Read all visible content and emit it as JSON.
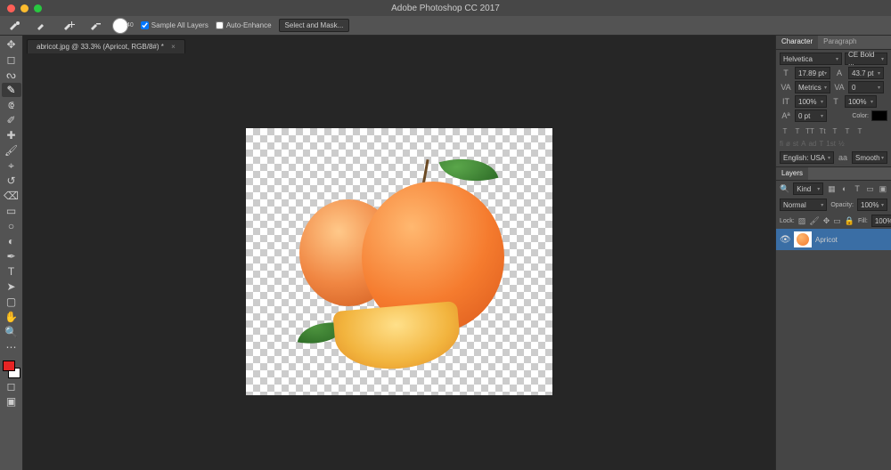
{
  "app": {
    "title": "Adobe Photoshop CC 2017"
  },
  "options": {
    "brush_size": "40",
    "sample_all_layers": "Sample All Layers",
    "auto_enhance": "Auto-Enhance",
    "select_and_mask": "Select and Mask..."
  },
  "document": {
    "tab_label": "abricot.jpg @ 33.3% (Apricot, RGB/8#) *"
  },
  "tools": {
    "items": [
      {
        "name": "move-tool",
        "glyph": "✥"
      },
      {
        "name": "marquee-tool",
        "glyph": "◻"
      },
      {
        "name": "lasso-tool",
        "glyph": "ᔓ"
      },
      {
        "name": "quick-selection-tool",
        "glyph": "✎",
        "active": true
      },
      {
        "name": "crop-tool",
        "glyph": "⟃"
      },
      {
        "name": "eyedropper-tool",
        "glyph": "✐"
      },
      {
        "name": "healing-brush-tool",
        "glyph": "✚"
      },
      {
        "name": "brush-tool",
        "glyph": "🖌"
      },
      {
        "name": "stamp-tool",
        "glyph": "⌖"
      },
      {
        "name": "history-brush-tool",
        "glyph": "↺"
      },
      {
        "name": "eraser-tool",
        "glyph": "⌫"
      },
      {
        "name": "gradient-tool",
        "glyph": "▭"
      },
      {
        "name": "blur-tool",
        "glyph": "○"
      },
      {
        "name": "dodge-tool",
        "glyph": "◐"
      },
      {
        "name": "pen-tool",
        "glyph": "✒"
      },
      {
        "name": "type-tool",
        "glyph": "T"
      },
      {
        "name": "path-selection-tool",
        "glyph": "➤"
      },
      {
        "name": "shape-tool",
        "glyph": "▢"
      },
      {
        "name": "hand-tool",
        "glyph": "✋"
      },
      {
        "name": "zoom-tool",
        "glyph": "🔍"
      },
      {
        "name": "edit-toolbar",
        "glyph": "⋯"
      }
    ]
  },
  "character_panel": {
    "tab_character": "Character",
    "tab_paragraph": "Paragraph",
    "font_family": "Helvetica",
    "font_style": "CE Bold ...",
    "font_size": "17.89 pt",
    "leading": "43.7 pt",
    "kerning": "Metrics",
    "tracking": "0",
    "vscale": "100%",
    "hscale": "100%",
    "baseline_shift": "0 pt",
    "color_label": "Color:",
    "styles": [
      "T",
      "T",
      "TT",
      "Tt",
      "T",
      "T",
      "T"
    ],
    "opentype": [
      "fi",
      "ø",
      "st",
      "A",
      "ad",
      "T",
      "1st",
      "½"
    ],
    "language": "English: USA",
    "aa": "Smooth"
  },
  "layers_panel": {
    "tab": "Layers",
    "filter_kind": "Kind",
    "blend_mode": "Normal",
    "opacity_label": "Opacity:",
    "opacity_value": "100%",
    "lock_label": "Lock:",
    "fill_label": "Fill:",
    "fill_value": "100%",
    "layer_name": "Apricot"
  }
}
